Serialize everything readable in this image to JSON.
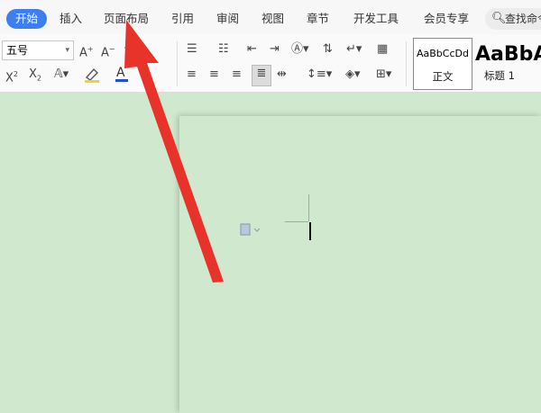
{
  "tabs": [
    {
      "label": "开始",
      "active": true
    },
    {
      "label": "插入"
    },
    {
      "label": "页面布局"
    },
    {
      "label": "引用"
    },
    {
      "label": "审阅"
    },
    {
      "label": "视图"
    },
    {
      "label": "章节"
    },
    {
      "label": "开发工具"
    },
    {
      "label": "会员专享"
    }
  ],
  "search": {
    "label": "查找命令"
  },
  "ribbon": {
    "font_size_value": "五号",
    "styles": [
      {
        "sample": "AaBbCcDd",
        "name": "正文"
      },
      {
        "sample": "AaBbA",
        "name": "标题 1"
      }
    ]
  },
  "colors": {
    "accent": "#3d7ff0",
    "canvas_bg": "#cfe8ce",
    "annotation_arrow": "#e8332a",
    "highlight": "#f4d03f",
    "font_color": "#1f4fd6"
  },
  "icons": [
    "increase-font-icon",
    "decrease-font-icon",
    "clear-format-icon",
    "superscript-icon",
    "subscript-icon",
    "text-effect-icon",
    "highlight-icon",
    "font-color-icon",
    "bullet-list-icon",
    "numbered-list-icon",
    "decrease-indent-icon",
    "increase-indent-icon",
    "chinese-layout-icon",
    "sort-icon",
    "show-marks-icon",
    "table-icon",
    "align-left-icon",
    "align-center-icon",
    "align-right-icon",
    "justify-icon",
    "distribute-icon",
    "line-spacing-icon",
    "shading-icon",
    "borders-icon",
    "paste-options-icon",
    "search-icon"
  ]
}
